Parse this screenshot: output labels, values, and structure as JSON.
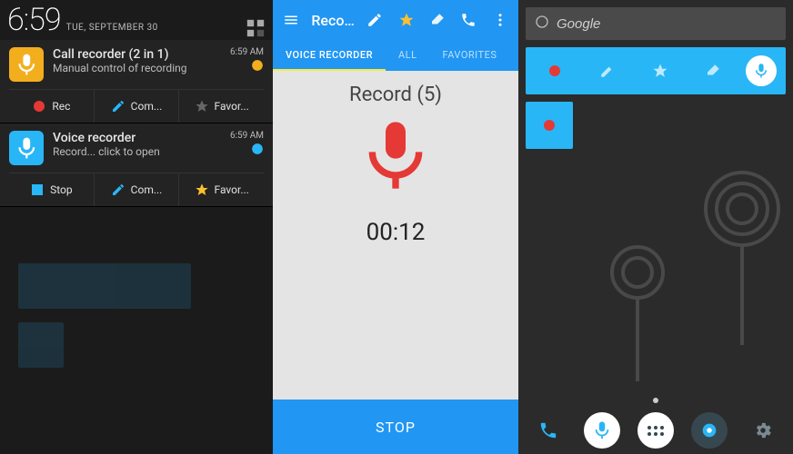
{
  "left": {
    "clock": "6:59",
    "date": "TUE, SEPTEMBER 30",
    "notifications": [
      {
        "title": "Call recorder (2 in 1)",
        "subtitle": "Manual control of recording",
        "time": "6:59 AM",
        "icon_color": "yellow",
        "actions": [
          "Rec",
          "Com...",
          "Favor..."
        ],
        "action_icons": [
          "record",
          "comment",
          "favorite"
        ]
      },
      {
        "title": "Voice recorder",
        "subtitle": "Record... click to open",
        "time": "6:59 AM",
        "icon_color": "cyan",
        "actions": [
          "Stop",
          "Com...",
          "Favor..."
        ],
        "action_icons": [
          "stop",
          "comment",
          "favorite-gold"
        ]
      }
    ]
  },
  "mid": {
    "appbar_title": "Recor...",
    "tabs": [
      "VOICE RECORDER",
      "ALL",
      "FAVORITES"
    ],
    "active_tab": 0,
    "record_label": "Record (5)",
    "timer": "00:12",
    "stop_label": "STOP"
  },
  "right": {
    "search_placeholder": "Google"
  }
}
